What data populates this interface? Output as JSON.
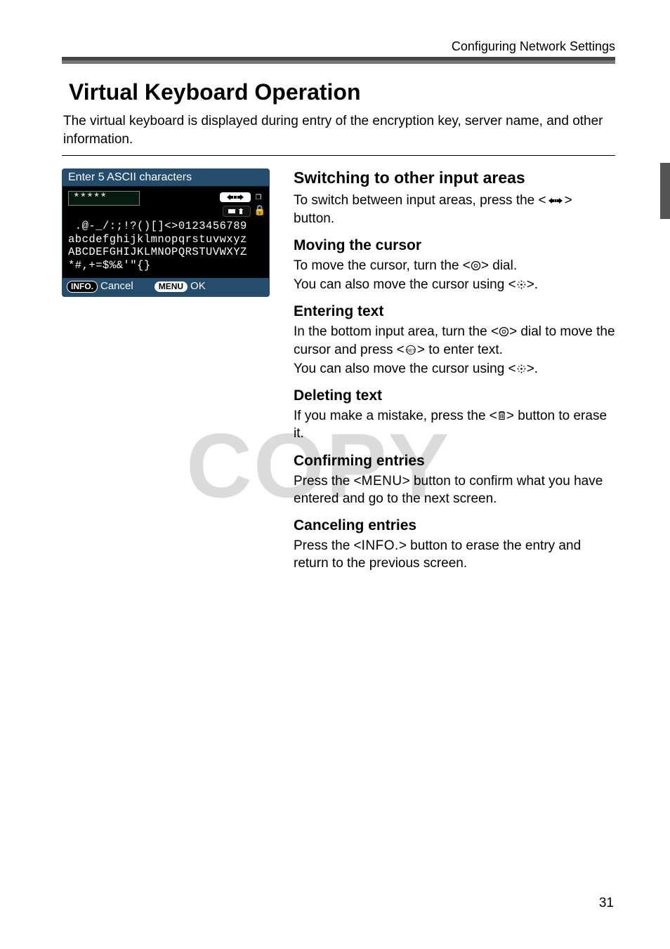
{
  "running_head": "Configuring Network Settings",
  "title": "Virtual Keyboard Operation",
  "lead": "The virtual keyboard is displayed during entry of the encryption key, server name, and other information.",
  "screenshot": {
    "title": "Enter 5 ASCII characters",
    "field_value": "*****",
    "kbd_lines": [
      " .@-_/:;!?()[]<>0123456789",
      "abcdefghijklmnopqrstuvwxyz",
      "ABCDEFGHIJKLMNOPQRSTUVWXYZ",
      "*#,+=$%&'\"{}"
    ],
    "foot_info_chip": "INFO.",
    "foot_info_label": "Cancel",
    "foot_menu_chip": "MENU",
    "foot_menu_label": "OK"
  },
  "sections": {
    "switch": {
      "h": "Switching to other input areas",
      "p1a": "To switch between input areas, press the <",
      "p1b": "> button."
    },
    "move": {
      "h": "Moving the cursor",
      "p1a": "To move the cursor, turn the <",
      "p1b": "> dial.",
      "p2a": "You can also move the cursor using <",
      "p2b": ">."
    },
    "enter": {
      "h": "Entering text",
      "p1a": "In the bottom input area, turn the <",
      "p1b": "> dial to move the cursor and press <",
      "p1c": "> to enter text.",
      "p2a": "You can also move the cursor using <",
      "p2b": ">."
    },
    "delete": {
      "h": "Deleting text",
      "p1a": "If you make a mistake, press the <",
      "p1b": "> button to erase it."
    },
    "confirm": {
      "h": "Confirming entries",
      "p1a": "Press the <",
      "menu": "MENU",
      "p1b": "> button to confirm what you have entered and go to the next screen."
    },
    "cancel": {
      "h": "Canceling entries",
      "p1a": "Press the <",
      "info": "INFO.",
      "p1b": "> button to erase the entry and return to the previous screen."
    }
  },
  "watermark": "COPY",
  "page_number": "31"
}
